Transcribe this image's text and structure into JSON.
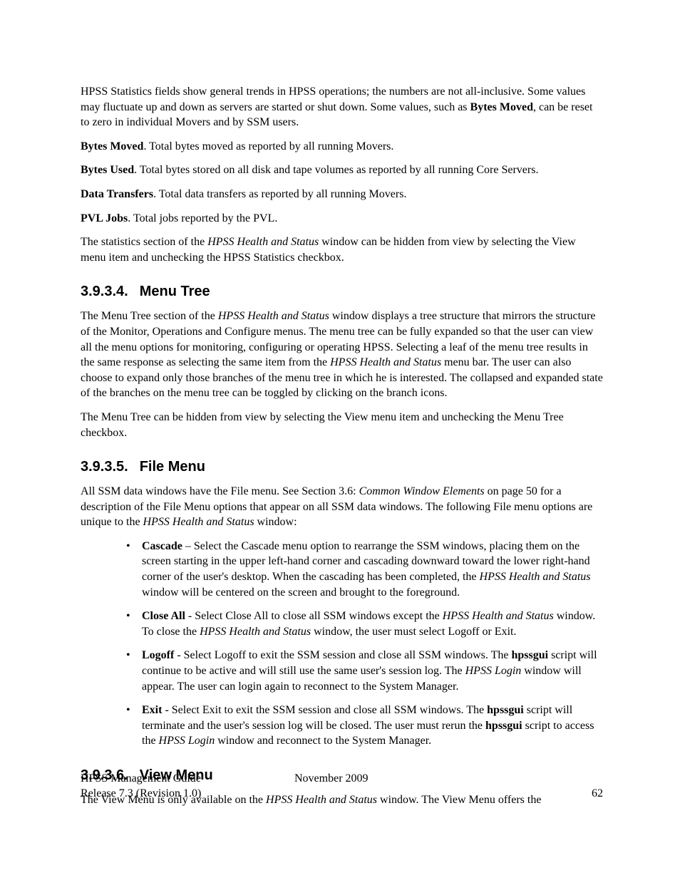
{
  "intro": {
    "p1a": "HPSS Statistics fields show general trends in HPSS operations; the numbers are not all-inclusive. Some values may fluctuate up and down as servers are started or shut down. Some values, such as ",
    "p1b": "Bytes Moved",
    "p1c": ", can be reset to zero in individual Movers and by SSM users.",
    "bytes_moved_label": "Bytes Moved",
    "bytes_moved_text": ". Total bytes moved as reported by all running Movers.",
    "bytes_used_label": "Bytes Used",
    "bytes_used_text": ". Total bytes stored on all disk and tape volumes as reported by all running Core Servers.",
    "data_transfers_label": "Data Transfers",
    "data_transfers_text": ". Total data transfers as reported by all running Movers.",
    "pvl_jobs_label": "PVL Jobs",
    "pvl_jobs_text": ". Total jobs reported by the PVL.",
    "stats_hide_a": "The statistics section of the ",
    "stats_hide_i": "HPSS Health and Status",
    "stats_hide_b": " window can be hidden from view by selecting the View menu item and unchecking the HPSS Statistics checkbox."
  },
  "s3934": {
    "num": "3.9.3.4.",
    "title": "Menu Tree",
    "p1a": "The Menu Tree section of the ",
    "p1i1": "HPSS Health and Status",
    "p1b": " window displays a tree structure that mirrors the structure of the Monitor, Operations and Configure menus. The menu tree can be fully expanded so that the user can view all the menu options for monitoring, configuring or operating HPSS.  Selecting a leaf of the menu tree results in the same response as selecting the same item from the ",
    "p1i2": "HPSS Health and Status",
    "p1c": " menu bar.   The user can also choose to expand only those branches of the menu tree in which he is interested.   The collapsed and expanded state of the branches on the menu tree can be toggled by clicking on the branch icons.",
    "p2": "The Menu Tree can be hidden from view by selecting the View menu item and unchecking the Menu Tree checkbox."
  },
  "s3935": {
    "num": "3.9.3.5.",
    "title": "File Menu",
    "p1a": "All SSM data windows have the File menu.  See Section 3.6: ",
    "p1i1": "Common Window Elements",
    "p1b": " on page 50 for a description of the File Menu options that appear on all SSM data windows.  The following File menu options are unique to the ",
    "p1i2": "HPSS Health and Status",
    "p1c": " window:",
    "cascade_label": "Cascade",
    "cascade_a": " – Select the Cascade menu option to rearrange the SSM windows, placing them on the screen starting in the upper left-hand corner and cascading downward toward the lower right-hand corner of the user's desktop. When the cascading has been completed, the ",
    "cascade_i": "HPSS Health and Status",
    "cascade_b": " window will be centered on the screen and brought to the foreground.",
    "closeall_label": "Close All",
    "closeall_a": " -   Select Close All to close all SSM windows except the ",
    "closeall_i1": "HPSS Health and Status",
    "closeall_b": " window. To close the ",
    "closeall_i2": "HPSS Health and Status",
    "closeall_c": " window, the user must select Logoff or Exit.",
    "logoff_label": "Logoff",
    "logoff_a": " - Select Logoff to exit the SSM session and close all SSM windows. The ",
    "logoff_b1": "hpssgui",
    "logoff_b": " script will continue to be active and will still use the same user's session log. The ",
    "logoff_i": "HPSS Login",
    "logoff_c": " window will appear. The user can login again to reconnect to the System Manager.",
    "exit_label": "Exit",
    "exit_a": " -  Select Exit to exit the SSM session and close all SSM windows. The ",
    "exit_b1": "hpssgui",
    "exit_b": " script will terminate and the user's session log will be closed. The user must rerun the ",
    "exit_b2": "hpssgui",
    "exit_c": " script to access the ",
    "exit_i": "HPSS Login",
    "exit_d": " window and reconnect to the System Manager."
  },
  "s3936": {
    "num": "3.9.3.6.",
    "title": "View Menu",
    "p1a": "The View Menu is only available on the ",
    "p1i": "HPSS Health and Status",
    "p1b": " window.  The View Menu offers the"
  },
  "footer": {
    "guide": "HPSS Management Guide",
    "date": "November 2009",
    "release": "Release 7.3 (Revision 1.0)",
    "page": "62"
  }
}
